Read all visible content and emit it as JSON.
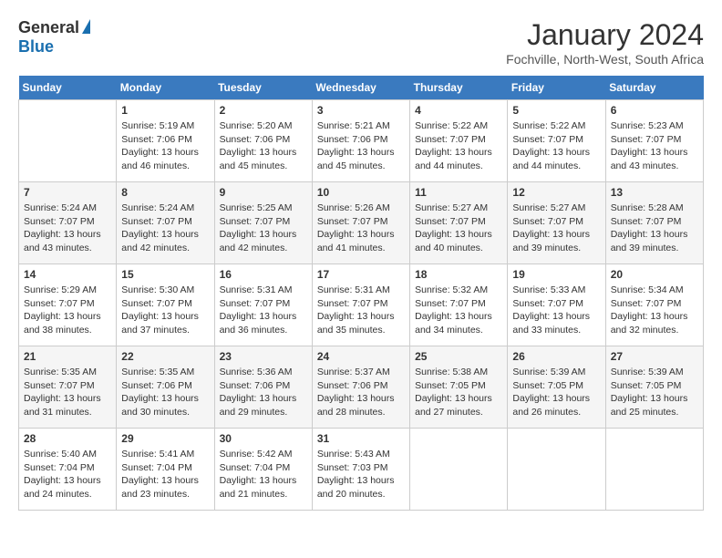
{
  "header": {
    "logo_general": "General",
    "logo_blue": "Blue",
    "title": "January 2024",
    "subtitle": "Fochville, North-West, South Africa"
  },
  "calendar": {
    "days_of_week": [
      "Sunday",
      "Monday",
      "Tuesday",
      "Wednesday",
      "Thursday",
      "Friday",
      "Saturday"
    ],
    "weeks": [
      [
        {
          "day": "",
          "detail": ""
        },
        {
          "day": "1",
          "detail": "Sunrise: 5:19 AM\nSunset: 7:06 PM\nDaylight: 13 hours\nand 46 minutes."
        },
        {
          "day": "2",
          "detail": "Sunrise: 5:20 AM\nSunset: 7:06 PM\nDaylight: 13 hours\nand 45 minutes."
        },
        {
          "day": "3",
          "detail": "Sunrise: 5:21 AM\nSunset: 7:06 PM\nDaylight: 13 hours\nand 45 minutes."
        },
        {
          "day": "4",
          "detail": "Sunrise: 5:22 AM\nSunset: 7:07 PM\nDaylight: 13 hours\nand 44 minutes."
        },
        {
          "day": "5",
          "detail": "Sunrise: 5:22 AM\nSunset: 7:07 PM\nDaylight: 13 hours\nand 44 minutes."
        },
        {
          "day": "6",
          "detail": "Sunrise: 5:23 AM\nSunset: 7:07 PM\nDaylight: 13 hours\nand 43 minutes."
        }
      ],
      [
        {
          "day": "7",
          "detail": "Sunrise: 5:24 AM\nSunset: 7:07 PM\nDaylight: 13 hours\nand 43 minutes."
        },
        {
          "day": "8",
          "detail": "Sunrise: 5:24 AM\nSunset: 7:07 PM\nDaylight: 13 hours\nand 42 minutes."
        },
        {
          "day": "9",
          "detail": "Sunrise: 5:25 AM\nSunset: 7:07 PM\nDaylight: 13 hours\nand 42 minutes."
        },
        {
          "day": "10",
          "detail": "Sunrise: 5:26 AM\nSunset: 7:07 PM\nDaylight: 13 hours\nand 41 minutes."
        },
        {
          "day": "11",
          "detail": "Sunrise: 5:27 AM\nSunset: 7:07 PM\nDaylight: 13 hours\nand 40 minutes."
        },
        {
          "day": "12",
          "detail": "Sunrise: 5:27 AM\nSunset: 7:07 PM\nDaylight: 13 hours\nand 39 minutes."
        },
        {
          "day": "13",
          "detail": "Sunrise: 5:28 AM\nSunset: 7:07 PM\nDaylight: 13 hours\nand 39 minutes."
        }
      ],
      [
        {
          "day": "14",
          "detail": "Sunrise: 5:29 AM\nSunset: 7:07 PM\nDaylight: 13 hours\nand 38 minutes."
        },
        {
          "day": "15",
          "detail": "Sunrise: 5:30 AM\nSunset: 7:07 PM\nDaylight: 13 hours\nand 37 minutes."
        },
        {
          "day": "16",
          "detail": "Sunrise: 5:31 AM\nSunset: 7:07 PM\nDaylight: 13 hours\nand 36 minutes."
        },
        {
          "day": "17",
          "detail": "Sunrise: 5:31 AM\nSunset: 7:07 PM\nDaylight: 13 hours\nand 35 minutes."
        },
        {
          "day": "18",
          "detail": "Sunrise: 5:32 AM\nSunset: 7:07 PM\nDaylight: 13 hours\nand 34 minutes."
        },
        {
          "day": "19",
          "detail": "Sunrise: 5:33 AM\nSunset: 7:07 PM\nDaylight: 13 hours\nand 33 minutes."
        },
        {
          "day": "20",
          "detail": "Sunrise: 5:34 AM\nSunset: 7:07 PM\nDaylight: 13 hours\nand 32 minutes."
        }
      ],
      [
        {
          "day": "21",
          "detail": "Sunrise: 5:35 AM\nSunset: 7:07 PM\nDaylight: 13 hours\nand 31 minutes."
        },
        {
          "day": "22",
          "detail": "Sunrise: 5:35 AM\nSunset: 7:06 PM\nDaylight: 13 hours\nand 30 minutes."
        },
        {
          "day": "23",
          "detail": "Sunrise: 5:36 AM\nSunset: 7:06 PM\nDaylight: 13 hours\nand 29 minutes."
        },
        {
          "day": "24",
          "detail": "Sunrise: 5:37 AM\nSunset: 7:06 PM\nDaylight: 13 hours\nand 28 minutes."
        },
        {
          "day": "25",
          "detail": "Sunrise: 5:38 AM\nSunset: 7:05 PM\nDaylight: 13 hours\nand 27 minutes."
        },
        {
          "day": "26",
          "detail": "Sunrise: 5:39 AM\nSunset: 7:05 PM\nDaylight: 13 hours\nand 26 minutes."
        },
        {
          "day": "27",
          "detail": "Sunrise: 5:39 AM\nSunset: 7:05 PM\nDaylight: 13 hours\nand 25 minutes."
        }
      ],
      [
        {
          "day": "28",
          "detail": "Sunrise: 5:40 AM\nSunset: 7:04 PM\nDaylight: 13 hours\nand 24 minutes."
        },
        {
          "day": "29",
          "detail": "Sunrise: 5:41 AM\nSunset: 7:04 PM\nDaylight: 13 hours\nand 23 minutes."
        },
        {
          "day": "30",
          "detail": "Sunrise: 5:42 AM\nSunset: 7:04 PM\nDaylight: 13 hours\nand 21 minutes."
        },
        {
          "day": "31",
          "detail": "Sunrise: 5:43 AM\nSunset: 7:03 PM\nDaylight: 13 hours\nand 20 minutes."
        },
        {
          "day": "",
          "detail": ""
        },
        {
          "day": "",
          "detail": ""
        },
        {
          "day": "",
          "detail": ""
        }
      ]
    ]
  }
}
